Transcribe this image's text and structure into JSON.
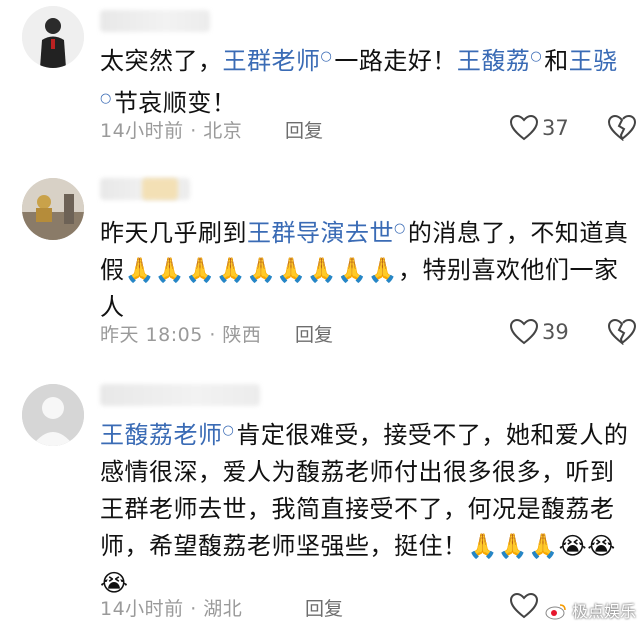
{
  "comments": [
    {
      "segments": [
        {
          "text": "太突然了，"
        },
        {
          "text": "王群老师",
          "link": true
        },
        {
          "text": "一路走好！"
        },
        {
          "text": "王馥荔",
          "link": true
        },
        {
          "text": "和"
        },
        {
          "text": "王骁",
          "link": true
        },
        {
          "text": "节哀顺变！"
        }
      ],
      "time": "14小时前 · 北京",
      "reply_label": "回复",
      "likes": "37"
    },
    {
      "segments": [
        {
          "text": "昨天几乎刷到"
        },
        {
          "text": "王群导演去世",
          "link": true
        },
        {
          "text": "的消息了，不知道真假"
        },
        {
          "text": "🙏🙏🙏🙏🙏🙏🙏🙏🙏",
          "emoji": true
        },
        {
          "text": "，特别喜欢他们一家人"
        }
      ],
      "time": "昨天 18:05 · 陕西",
      "reply_label": "回复",
      "likes": "39"
    },
    {
      "segments": [
        {
          "text": "王馥荔老师",
          "link": true
        },
        {
          "text": "肯定很难受，接受不了，她和爱人的感情很深，爱人为馥荔老师付出很多很多，听到王群老师去世，我简直接受不了，何况是馥荔老师，希望馥荔老师坚强些，挺住！"
        },
        {
          "text": "🙏🙏🙏😭😭😭",
          "emoji": true
        }
      ],
      "time": "14小时前 · 湖北",
      "reply_label": "回复",
      "likes": ""
    }
  ],
  "watermark": "极点娱乐",
  "colors": {
    "link": "#3a6bb5",
    "meta": "#9a9a9a",
    "text": "#111111"
  }
}
